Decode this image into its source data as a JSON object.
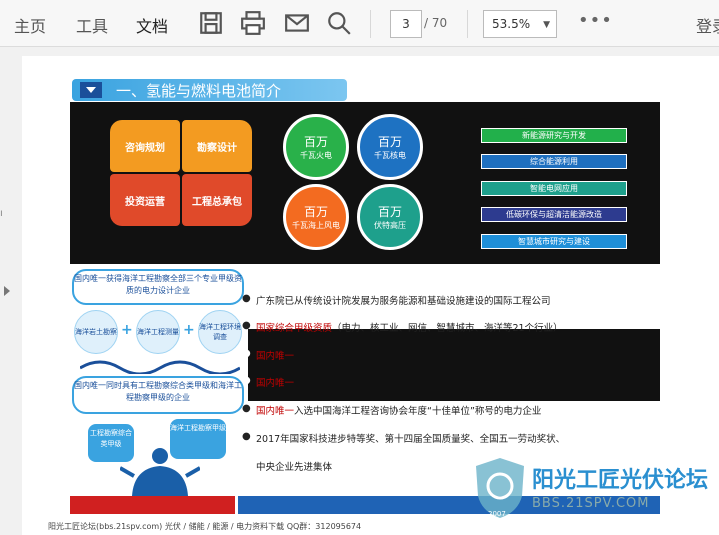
{
  "toolbar": {
    "menu_home": "主页",
    "menu_tools": "工具",
    "menu_doc": "文档",
    "page_current": "3",
    "page_total": "/ 70",
    "zoom": "53.5%",
    "more": "•••",
    "login": "登录"
  },
  "slide": {
    "section_title": "一、氢能与燃料电池简介",
    "gears": [
      "咨询规划",
      "勘察设计",
      "投资运营",
      "工程总承包"
    ],
    "circles": [
      {
        "big": "百万",
        "small": "千瓦火电"
      },
      {
        "big": "百万",
        "small": "千瓦核电"
      },
      {
        "big": "百万",
        "small": "千瓦海上风电"
      },
      {
        "big": "百万",
        "small": "伏特高压"
      }
    ],
    "bars": [
      "新能源研究与开发",
      "综合能源利用",
      "智能电网应用",
      "低碳环保与超清洁能源改造",
      "智慧城市研究与建设"
    ],
    "left_top": "国内唯一获得海洋工程勘察全部三个专业甲级资质的电力设计企业",
    "left_circles": [
      "海洋岩土勘察",
      "海洋工程测量",
      "海洋工程环境调查"
    ],
    "left_mid": "国内唯一同时具有工程勘察综合类甲级和海洋工程勘察甲级的企业",
    "left_bottom_a": "工程勘察综合类甲级",
    "left_bottom_b": "海洋工程勘察甲级",
    "bullets": {
      "b1": "广东院已从传统设计院发展为服务能源和基础设施建设的国际工程公司",
      "b2_red": "国家综合甲级资质",
      "b2_rest": "（电力、核工业、网信、智慧城市、海洋等21个行业）",
      "b3": "国内唯一",
      "b4": "国内唯一",
      "b5_red": "国内唯一",
      "b5_rest": "入选中国海洋工程咨询协会年度“十佳单位”称号的电力企业",
      "b6": "2017年国家科技进步特等奖、第十四届全国质量奖、全国五一劳动奖状、",
      "b6b": "中央企业先进集体"
    },
    "footer": "阳光工匠论坛(bbs.21spv.com)     光伏 / 储能 / 能源 / 电力资料下载     QQ群：312095674"
  },
  "watermark": {
    "title": "阳光工匠光伏论坛",
    "url": "BBS.21SPV.COM",
    "year": "2007"
  },
  "colors": {
    "accent": "#3aa3e0",
    "red": "#c00000",
    "navy": "#1a4f9a"
  }
}
